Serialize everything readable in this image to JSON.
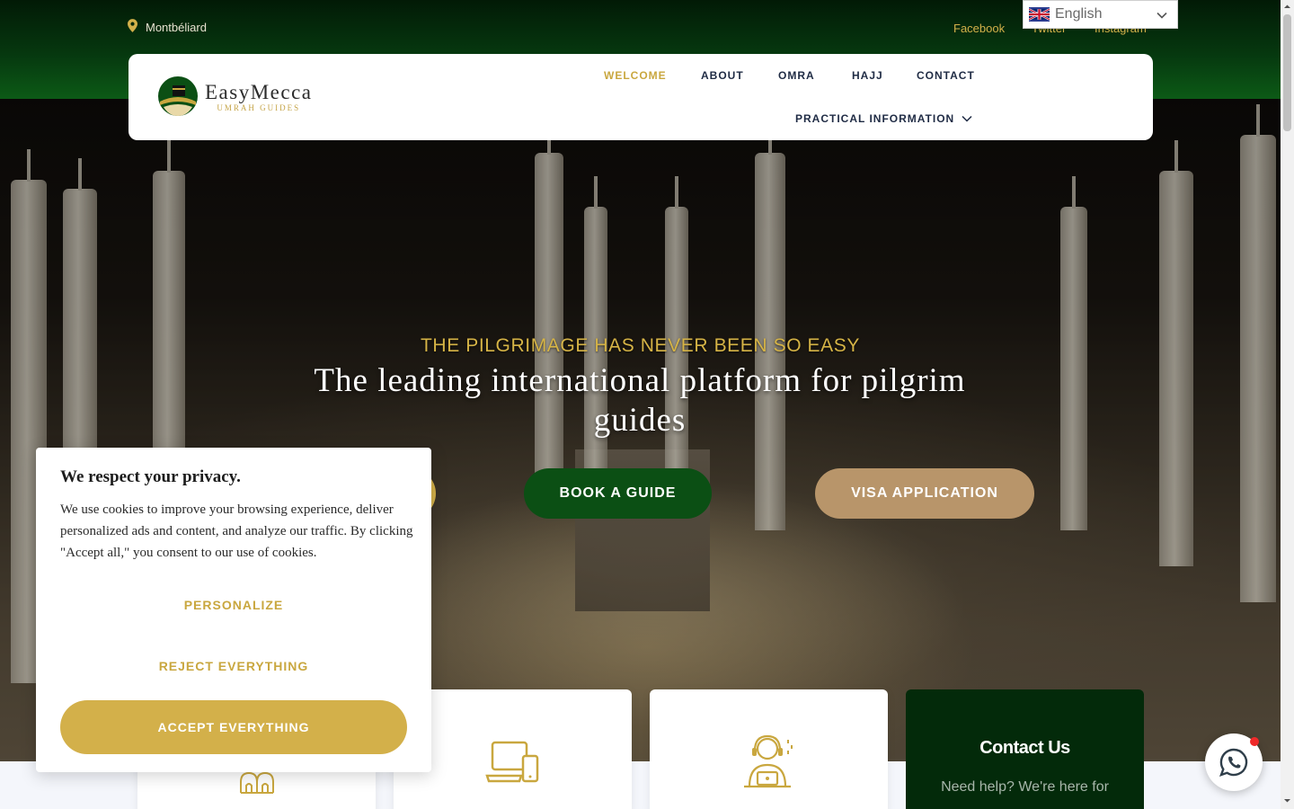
{
  "topbar": {
    "location": "Montbéliard",
    "social": [
      "Facebook",
      "Twitter",
      "Instagram"
    ]
  },
  "language": {
    "selected": "English"
  },
  "logo": {
    "name": "EasyMecca",
    "subtitle": "UMRAH GUIDES"
  },
  "nav": {
    "items": [
      "WELCOME",
      "ABOUT",
      "OMRA",
      "HAJJ",
      "CONTACT"
    ],
    "dropdown_label": "PRACTICAL INFORMATION",
    "active": "WELCOME"
  },
  "hero": {
    "kicker": "THE PILGRIMAGE HAS NEVER BEEN SO EASY",
    "title": "The leading international platform for pilgrim guides",
    "buttons": {
      "book": "BOOK A GUIDE",
      "visa": "VISA APPLICATION"
    }
  },
  "cookie": {
    "title": "We respect your privacy.",
    "text": "We use cookies to improve your browsing experience, deliver personalized ads and content, and analyze our traffic. By clicking \"Accept all,\" you consent to our use of cookies.",
    "personalize": "PERSONALIZE",
    "reject": "REJECT EVERYTHING",
    "accept": "ACCEPT EVERYTHING"
  },
  "contact_card": {
    "title": "Contact Us",
    "subtitle": "Need help? We're here for"
  },
  "icons": {
    "location": "map-pin-icon",
    "flag": "uk-flag-icon",
    "dropdown": "chevron-down-icon",
    "card1": "mosque-domes-icon",
    "card2": "laptop-phone-icon",
    "card3": "support-agent-icon",
    "whatsapp": "whatsapp-icon"
  },
  "colors": {
    "gold": "#d3b04a",
    "dark_green": "#0b4f14",
    "tan": "#b8956a",
    "navy_text": "#1f2b44"
  }
}
